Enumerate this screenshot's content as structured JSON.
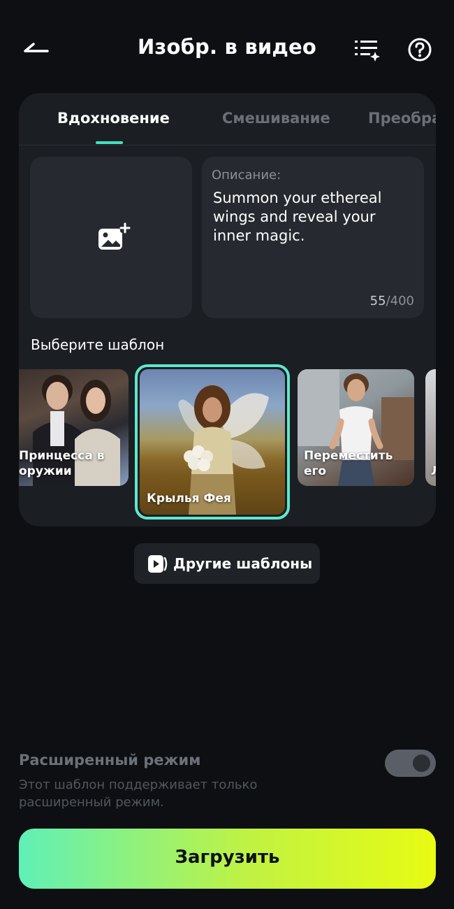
{
  "header": {
    "title": "Изобр. в видео",
    "icons": {
      "back": "back-arrow-icon",
      "list": "list-sparkle-icon",
      "help": "help-circle-icon"
    }
  },
  "tabs": [
    {
      "label": "Вдохновение",
      "active": true
    },
    {
      "label": "Смешивание",
      "active": false
    },
    {
      "label": "Преобра",
      "active": false
    }
  ],
  "upload": {
    "icon": "add-image-icon"
  },
  "description": {
    "label": "Описание:",
    "text": "Summon your ethereal wings and reveal your inner magic.",
    "count": "55",
    "max": "/400"
  },
  "templates": {
    "section_label": "Выберите шаблон",
    "items": [
      {
        "label": "Принцесса в оружии",
        "selected": false
      },
      {
        "label": "Крылья Фея",
        "selected": true
      },
      {
        "label": "Переместить его",
        "selected": false
      },
      {
        "label": "Л",
        "selected": false
      }
    ]
  },
  "more_templates": {
    "label": "Другие шаблоны",
    "icon": "video-play-icon"
  },
  "advanced": {
    "title": "Расширенный режим",
    "description": "Этот шаблон поддерживает только расширенный режим.",
    "toggle_on": true
  },
  "upload_button": {
    "label": "Загрузить"
  },
  "colors": {
    "accent": "#3fe3c0",
    "background": "#0d0f12",
    "card": "#1b1e23",
    "button_gradient_start": "#5ff0b7",
    "button_gradient_end": "#e8fb12"
  }
}
